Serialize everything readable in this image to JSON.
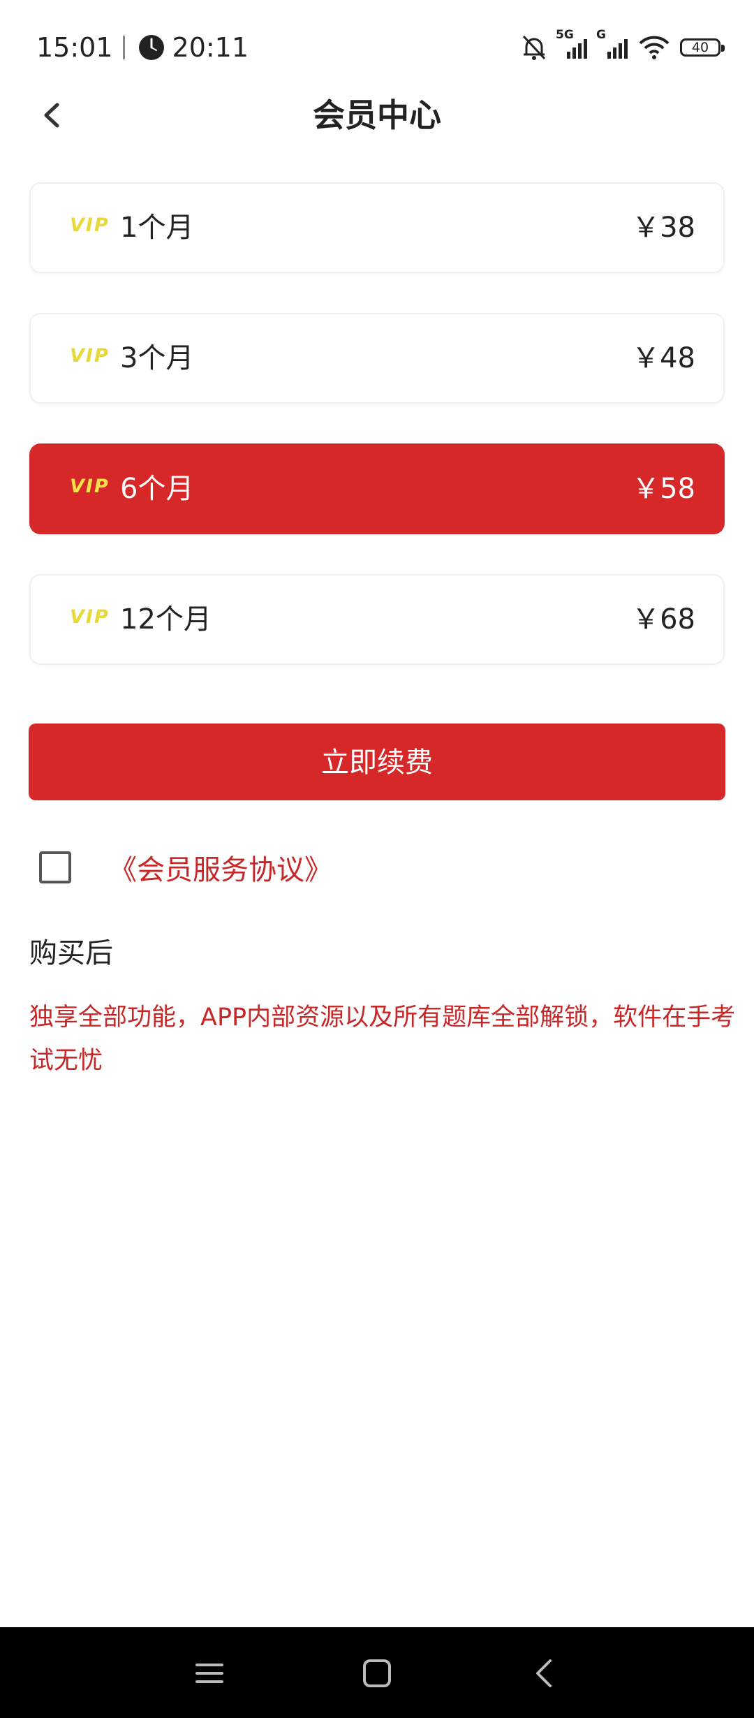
{
  "status_bar": {
    "time": "15:01",
    "clock_time": "20:11",
    "network_1": "5G",
    "network_2": "G",
    "battery": "40",
    "icons": [
      "bell-off-icon",
      "clock-icon",
      "signal-icon",
      "wifi-icon",
      "battery-icon"
    ]
  },
  "header": {
    "title": "会员中心",
    "back_icon": "chevron-left-icon"
  },
  "plans": [
    {
      "badge": "VIP",
      "label": "1个月",
      "price": "￥38",
      "selected": false
    },
    {
      "badge": "VIP",
      "label": "3个月",
      "price": "￥48",
      "selected": false
    },
    {
      "badge": "VIP",
      "label": "6个月",
      "price": "￥58",
      "selected": true
    },
    {
      "badge": "VIP",
      "label": "12个月",
      "price": "￥68",
      "selected": false
    }
  ],
  "renew_button": "立即续费",
  "agreement": {
    "checked": false,
    "link_text": "《会员服务协议》"
  },
  "after_purchase": {
    "title": "购买后",
    "description": "独享全部功能，APP内部资源以及所有题库全部解锁，软件在手考试无忧"
  },
  "nav_bar": {
    "icons": [
      "menu-icon",
      "home-icon",
      "back-icon"
    ]
  },
  "colors": {
    "accent": "#d62829",
    "link": "#c82727",
    "vip_badge": "#e8d93a"
  }
}
